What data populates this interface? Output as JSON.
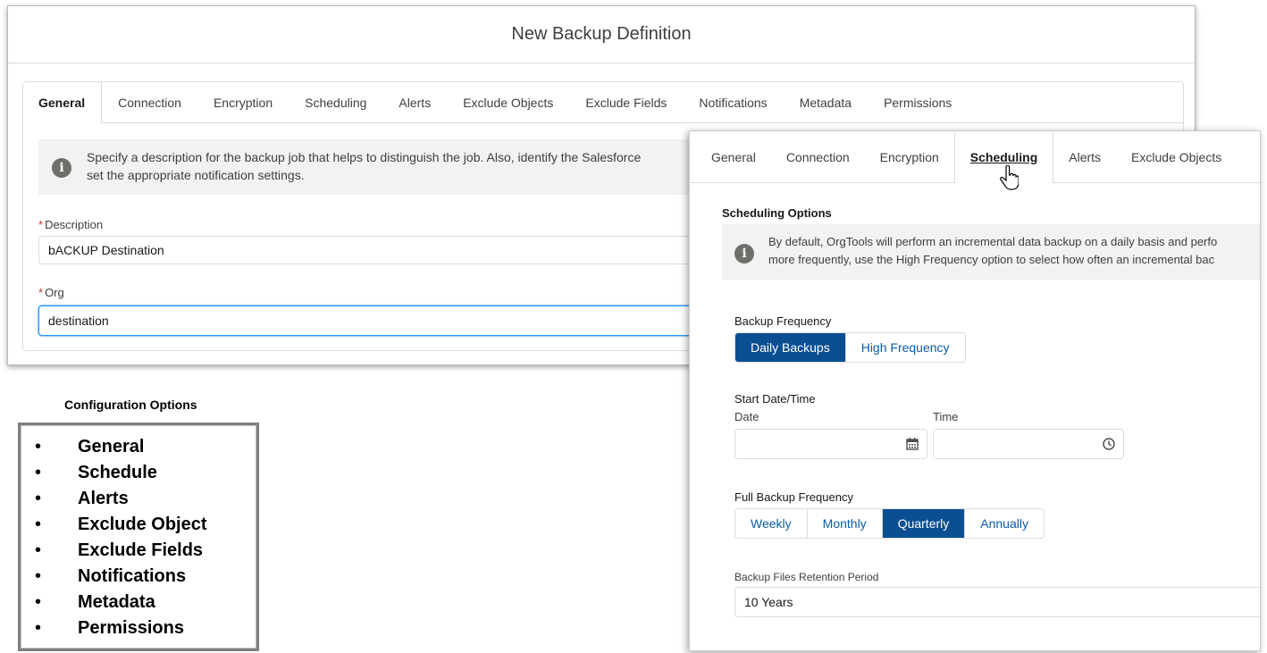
{
  "modal": {
    "title": "New Backup Definition",
    "tabs": [
      "General",
      "Connection",
      "Encryption",
      "Scheduling",
      "Alerts",
      "Exclude Objects",
      "Exclude Fields",
      "Notifications",
      "Metadata",
      "Permissions"
    ],
    "active_tab": "General",
    "info_text_line1": "Specify a description for the backup job that helps to distinguish the job. Also, identify the Salesforce",
    "info_text_line2": "set the appropriate notification settings.",
    "description_label": "Description",
    "description_value": "bACKUP Destination",
    "org_label": "Org",
    "org_value": "destination"
  },
  "config": {
    "title": "Configuration Options",
    "items": [
      "General",
      "Schedule",
      "Alerts",
      "Exclude Object",
      "Exclude Fields",
      "Notifications",
      "Metadata",
      "Permissions"
    ]
  },
  "scheduling": {
    "tabs": [
      "General",
      "Connection",
      "Encryption",
      "Scheduling",
      "Alerts",
      "Exclude Objects"
    ],
    "active_tab": "Scheduling",
    "options_title": "Scheduling Options",
    "info_line1": "By default, OrgTools will perform an incremental data backup on a daily basis and perfo",
    "info_line2": "more frequently, use the High Frequency option to select how often an incremental bac",
    "backup_frequency_label": "Backup Frequency",
    "backup_frequency_options": [
      "Daily Backups",
      "High Frequency"
    ],
    "backup_frequency_selected": "Daily Backups",
    "start_label": "Start Date/Time",
    "date_label": "Date",
    "time_label": "Time",
    "date_value": "",
    "time_value": "",
    "full_backup_label": "Full Backup Frequency",
    "full_backup_options": [
      "Weekly",
      "Monthly",
      "Quarterly",
      "Annually"
    ],
    "full_backup_selected": "Quarterly",
    "retention_label": "Backup Files Retention Period",
    "retention_value": "10 Years"
  },
  "icons": [
    "info-icon",
    "calendar-icon",
    "clock-icon",
    "hand-cursor-icon"
  ],
  "colors": {
    "brand_selected": "#0b4f93",
    "required": "#c23934",
    "focus_border": "#1b96ff"
  }
}
